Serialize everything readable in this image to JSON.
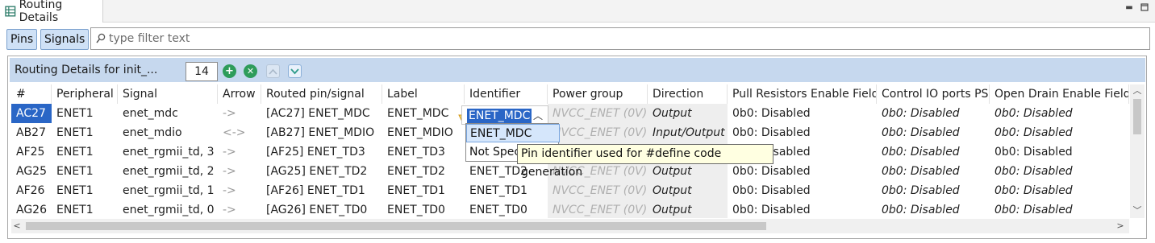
{
  "tab": {
    "title": "Routing Details"
  },
  "toggles": {
    "pins": "Pins",
    "signals": "Signals"
  },
  "filter": {
    "placeholder": "type filter text"
  },
  "panel": {
    "title": "Routing Details for init_...",
    "count": "14"
  },
  "table": {
    "columns": [
      "#",
      "Peripheral",
      "Signal",
      "Arrow",
      "Routed pin/signal",
      "Label",
      "Identifier",
      "Power group",
      "Direction",
      "Pull Resistors Enable Field",
      "Control IO ports PS",
      "Open Drain Enable Field"
    ],
    "rows": [
      [
        "AC27",
        "ENET1",
        "enet_mdc",
        "->",
        "[AC27] ENET_MDC",
        "ENET_MDC",
        "",
        "NVCC_ENET (0V)",
        "Output",
        "0b0: Disabled",
        "0b0: Disabled",
        "0b0: Disabled"
      ],
      [
        "AB27",
        "ENET1",
        "enet_mdio",
        "<->",
        "[AB27] ENET_MDIO",
        "ENET_MDIO",
        "",
        "NVCC_ENET (0V)",
        "Input/Output",
        "0b0: Disabled",
        "0b0: Disabled",
        "0b0: Disabled"
      ],
      [
        "AF25",
        "ENET1",
        "enet_rgmii_td, 3",
        "->",
        "[AF25] ENET_TD3",
        "ENET_TD3",
        "",
        "NVCC_ENET (0V)",
        "Output",
        "0b0: Disabled",
        "0b0: Disabled",
        "0b0: Disabled"
      ],
      [
        "AG25",
        "ENET1",
        "enet_rgmii_td, 2",
        "->",
        "[AG25] ENET_TD2",
        "ENET_TD2",
        "ENET_TD2",
        "NVCC_ENET (0V)",
        "Output",
        "0b0: Disabled",
        "0b0: Disabled",
        "0b0: Disabled"
      ],
      [
        "AF26",
        "ENET1",
        "enet_rgmii_td, 1",
        "->",
        "[AF26] ENET_TD1",
        "ENET_TD1",
        "ENET_TD1",
        "NVCC_ENET (0V)",
        "Output",
        "0b0: Disabled",
        "0b0: Disabled",
        "0b0: Disabled"
      ],
      [
        "AG26",
        "ENET1",
        "enet_rgmii_td, 0",
        "->",
        "[AG26] ENET_TD0",
        "ENET_TD0",
        "ENET_TD0",
        "NVCC_ENET (0V)",
        "Output",
        "0b0: Disabled",
        "0b0: Disabled",
        "0b0: Disabled"
      ]
    ]
  },
  "identifier_editor": {
    "value": "ENET_MDC"
  },
  "identifier_dropdown": {
    "options": [
      "ENET_MDC",
      "Not Spec"
    ]
  },
  "tooltip": {
    "text": "Pin identifier used for #define code generation"
  },
  "colors": {
    "accent": "#2a66c6",
    "header_bg": "#c6d8ee",
    "toggle_bg": "#cfe1f6",
    "tooltip_bg": "#ffffe1",
    "add_green": "#2e9c5a"
  },
  "icons": [
    "routing-table-icon",
    "minimize-icon",
    "maximize-icon",
    "search-icon",
    "add-icon",
    "remove-icon",
    "move-up-icon",
    "move-down-icon",
    "warning-marker-icon",
    "scroll-up-icon",
    "scroll-down-icon",
    "scroll-left-icon",
    "scroll-right-icon",
    "chevron-up-icon"
  ]
}
